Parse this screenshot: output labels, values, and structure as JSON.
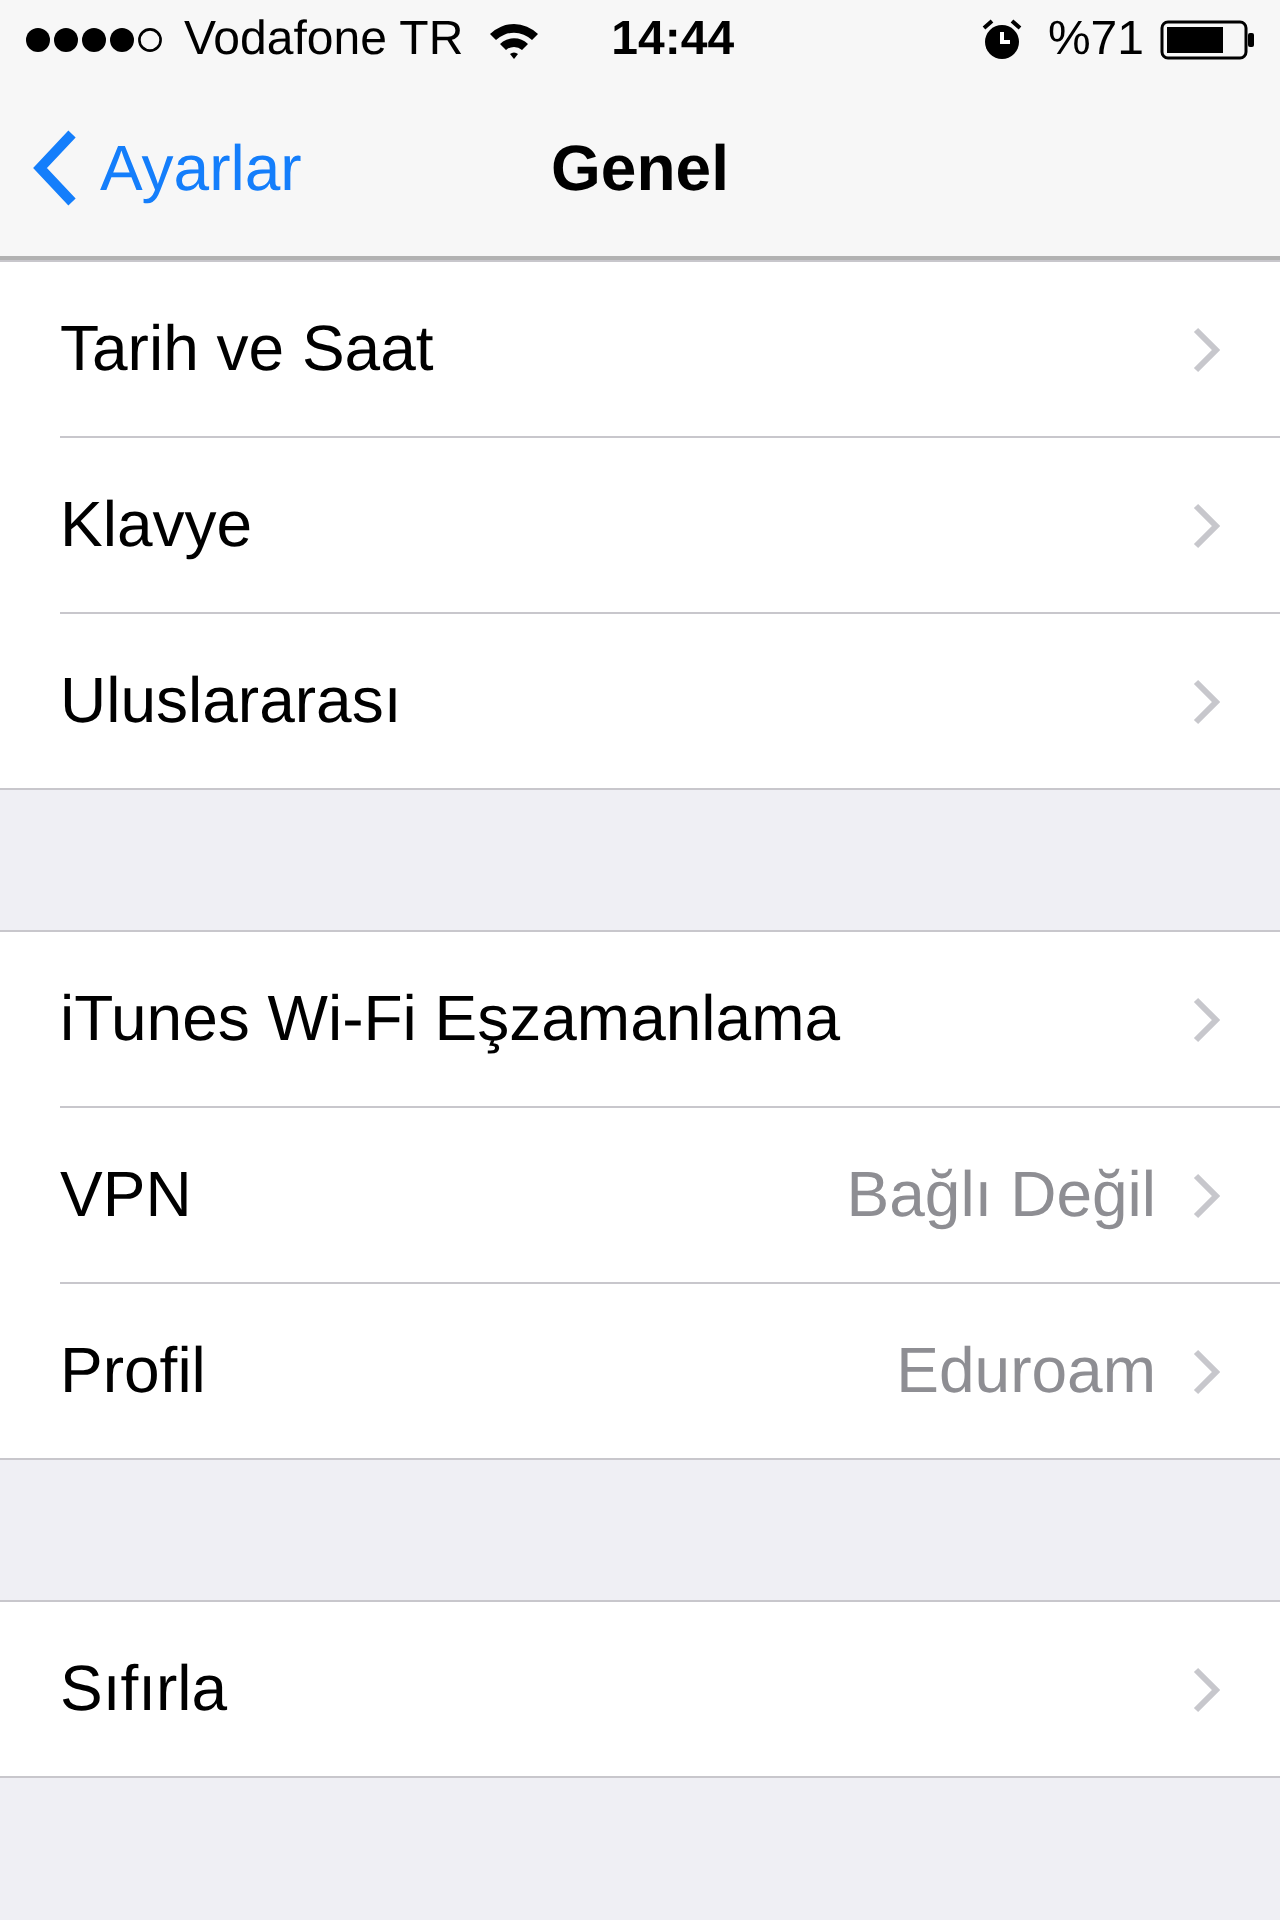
{
  "status_bar": {
    "carrier": "Vodafone TR",
    "time": "14:44",
    "battery_text": "%71"
  },
  "nav_bar": {
    "back": "Ayarlar",
    "title": "Genel"
  },
  "groups": [
    {
      "rows": [
        {
          "label": "Tarih ve Saat"
        },
        {
          "label": "Klavye"
        },
        {
          "label": "Uluslararası"
        }
      ]
    },
    {
      "rows": [
        {
          "label": "iTunes Wi-Fi Eşzamanlama"
        },
        {
          "label": "VPN",
          "value": "Bağlı Değil"
        },
        {
          "label": "Profil",
          "value": "Eduroam"
        }
      ]
    },
    {
      "rows": [
        {
          "label": "Sıfırla"
        }
      ]
    }
  ]
}
